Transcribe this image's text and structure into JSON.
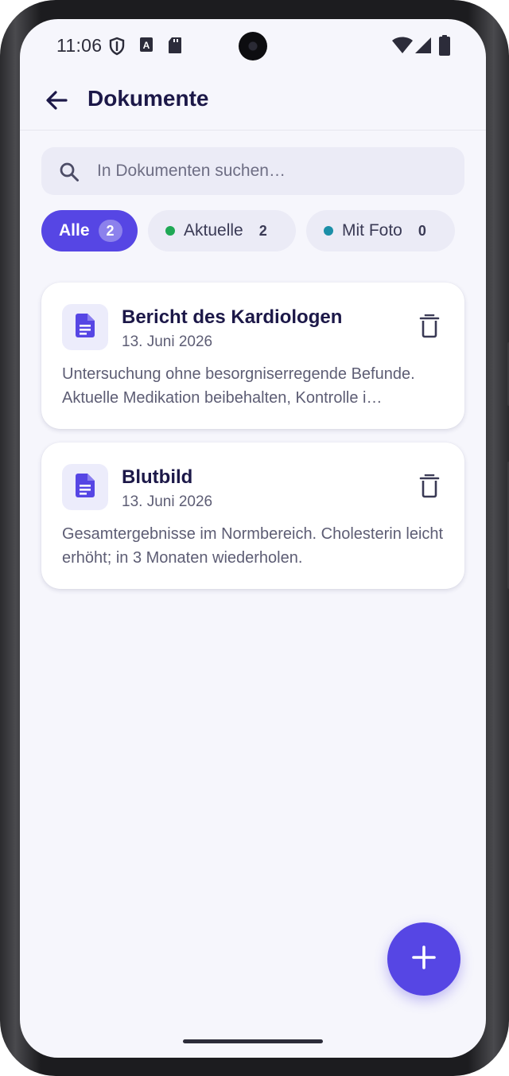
{
  "status_bar": {
    "time": "11:06",
    "icons": [
      "shield-icon",
      "font-a-icon",
      "sd-card-icon",
      "camera-cutout",
      "wifi-icon",
      "cell-signal-icon",
      "battery-icon"
    ]
  },
  "header": {
    "back_icon": "arrow-left-icon",
    "title": "Dokumente"
  },
  "search": {
    "icon": "search-icon",
    "placeholder": "In Dokumenten suchen…",
    "value": ""
  },
  "filters": [
    {
      "label": "Alle",
      "count": "2",
      "selected": true
    },
    {
      "label": "Aktuelle",
      "count": "2",
      "dot_color": "#1fa855",
      "selected": false
    },
    {
      "label": "Mit Foto",
      "count": "0",
      "dot_color": "#1b8fa8",
      "selected": false
    }
  ],
  "documents": [
    {
      "icon": "document-icon",
      "title": "Bericht des Kardiologen",
      "date": "13. Juni 2026",
      "summary": "Untersuchung ohne besorgniserregende Befunde. Aktuelle Medikation beibehalten, Kontrolle i…",
      "delete_icon": "trash-icon"
    },
    {
      "icon": "document-icon",
      "title": "Blutbild",
      "date": "13. Juni 2026",
      "summary": "Gesamtergebnisse im Normbereich. Cholesterin leicht erhöht; in 3 Monaten wiederholen.",
      "delete_icon": "trash-icon"
    }
  ],
  "fab": {
    "icon": "plus-icon"
  },
  "colors": {
    "accent": "#5646e4",
    "title_text": "#1c1848",
    "body_text": "#5d5d74",
    "background": "#f6f6fc",
    "chip_background": "#ebebf6"
  }
}
